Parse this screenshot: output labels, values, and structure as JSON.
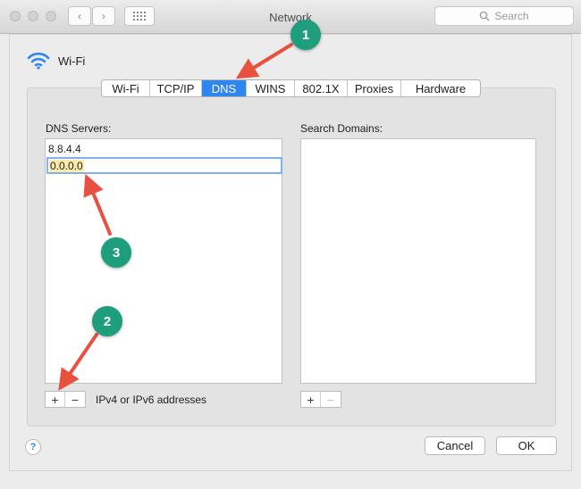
{
  "window": {
    "title": "Network"
  },
  "search": {
    "placeholder": "Search"
  },
  "interface": {
    "label": "Wi-Fi"
  },
  "tabs": [
    {
      "label": "Wi-Fi",
      "active": false
    },
    {
      "label": "TCP/IP",
      "active": false
    },
    {
      "label": "DNS",
      "active": true
    },
    {
      "label": "WINS",
      "active": false
    },
    {
      "label": "802.1X",
      "active": false
    },
    {
      "label": "Proxies",
      "active": false
    },
    {
      "label": "Hardware",
      "active": false
    }
  ],
  "dns": {
    "label": "DNS Servers:",
    "servers": [
      "8.8.4.4"
    ],
    "editing_value": "0.0.0.0",
    "add_label": "+",
    "remove_label": "−",
    "hint": "IPv4 or IPv6 addresses"
  },
  "search_domains": {
    "label": "Search Domains:",
    "add_label": "+",
    "remove_label": "−"
  },
  "footer": {
    "help_label": "?",
    "cancel_label": "Cancel",
    "ok_label": "OK"
  },
  "annotations": [
    {
      "number": "1"
    },
    {
      "number": "2"
    },
    {
      "number": "3"
    }
  ],
  "colors": {
    "accent": "#2f86ee",
    "badge": "#1e9e7d",
    "arrow": "#e8503f",
    "edit_highlight": "#fde9a8"
  }
}
